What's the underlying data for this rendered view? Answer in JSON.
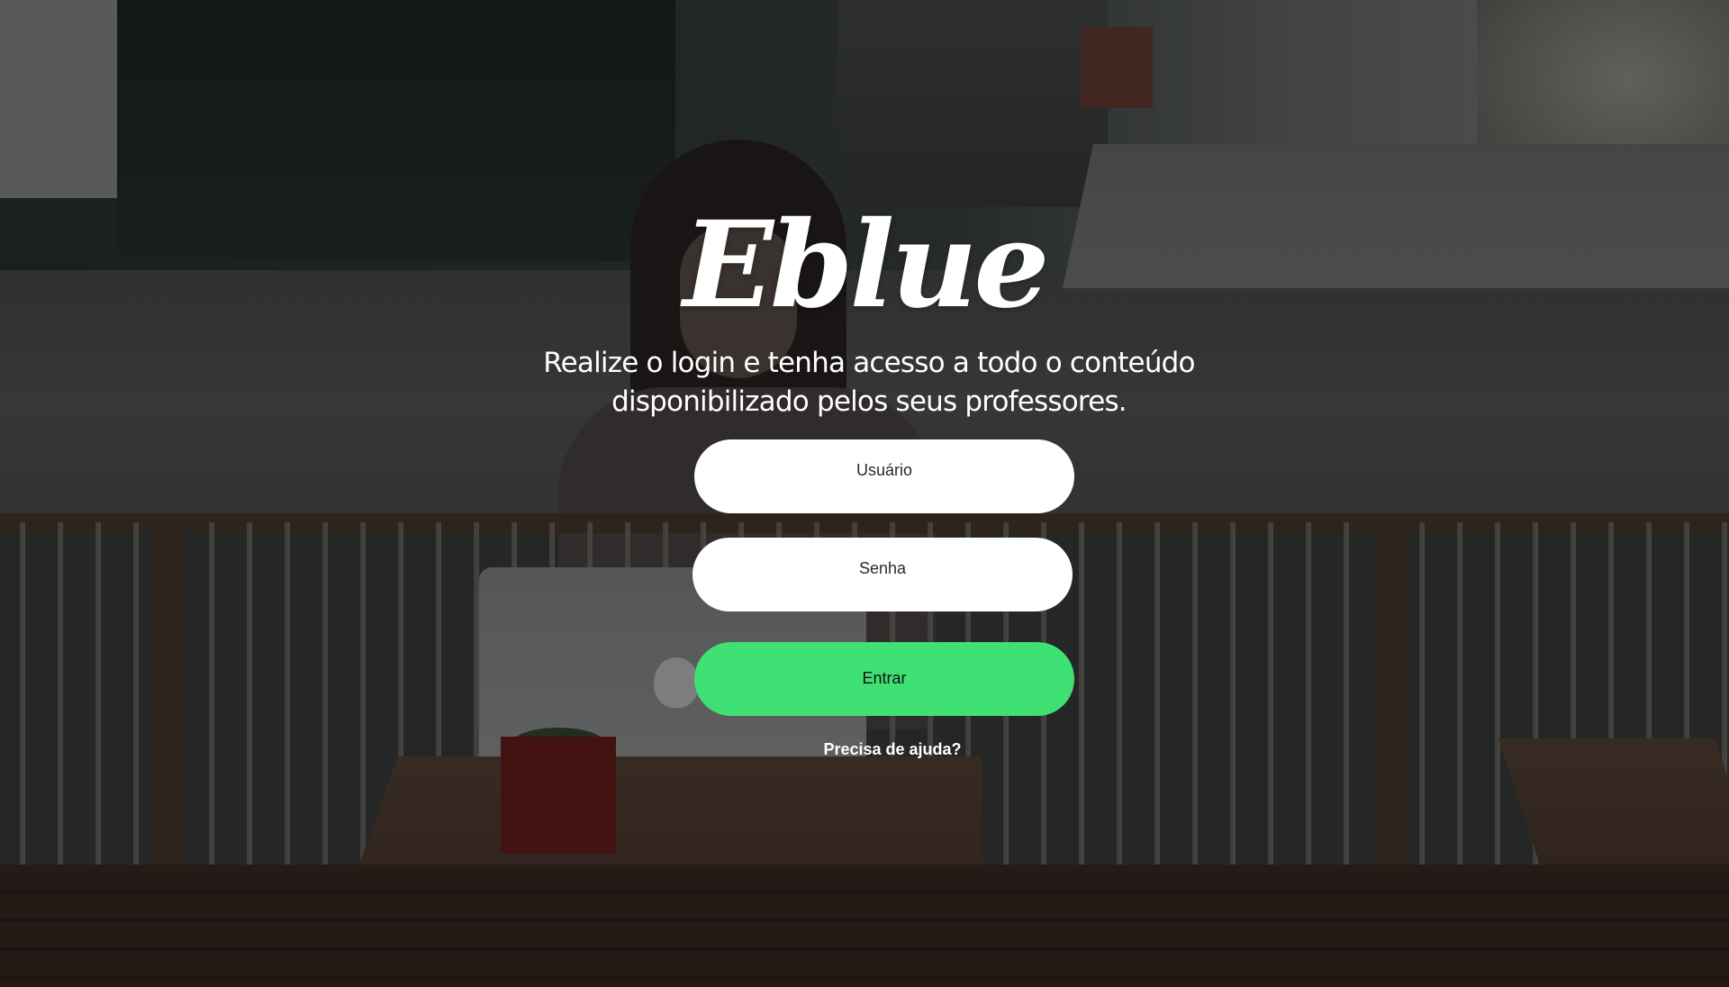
{
  "brand": {
    "logo_text": "Eblue"
  },
  "login": {
    "tagline_line1": "Realize o login e tenha acesso a todo o conteúdo",
    "tagline_line2": "disponibilizado pelos seus professores.",
    "username_placeholder": "Usuário",
    "password_placeholder": "Senha",
    "submit_label": "Entrar",
    "help_link": "Precisa de ajuda?"
  },
  "colors": {
    "accent_green": "#3fe074",
    "field_background": "#ffffff",
    "text_light": "#ffffff"
  }
}
